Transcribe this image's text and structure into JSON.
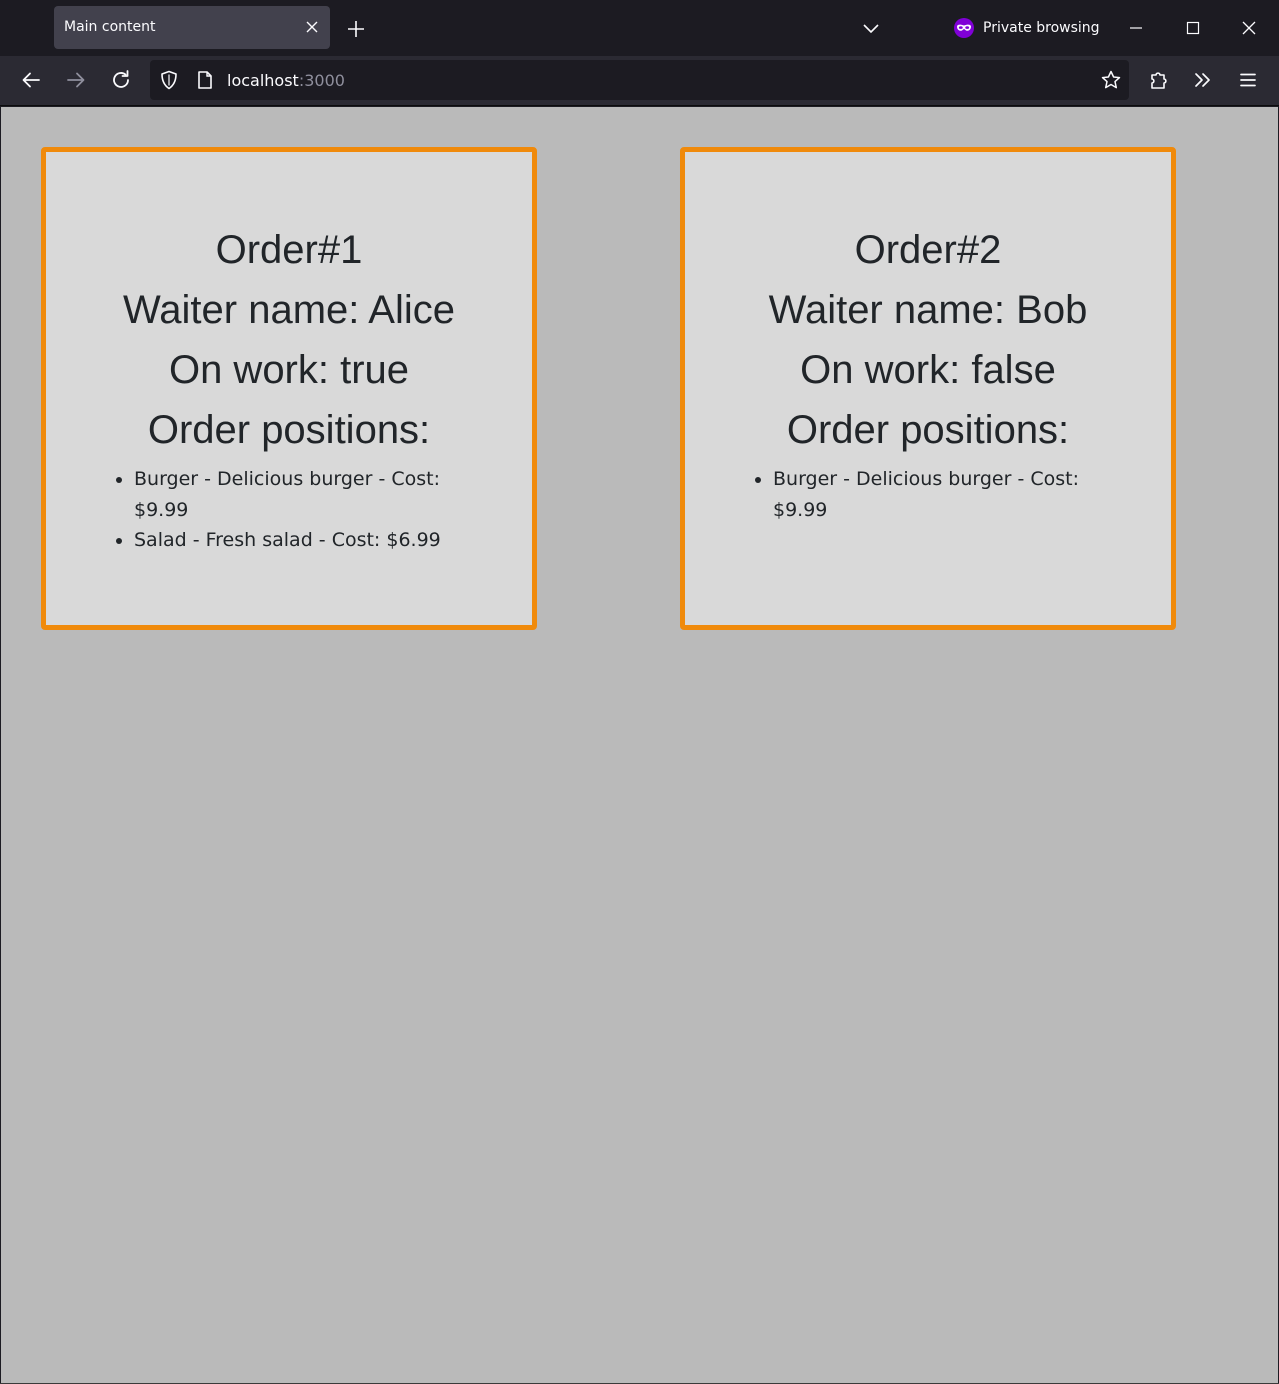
{
  "browser": {
    "tab": {
      "title": "Main content"
    },
    "private_label": "Private browsing",
    "url": {
      "host": "localhost",
      "port": ":3000"
    }
  },
  "colors": {
    "card_border": "#f08a0b",
    "card_background": "#d9d9d9",
    "page_background": "#bababa",
    "private_icon": "#8000d7"
  },
  "icons": {
    "tab_close": "close-icon",
    "new_tab": "plus-icon",
    "tab_list": "chevron-down-icon",
    "private": "private-mask-icon",
    "back": "arrow-left-icon",
    "forward": "arrow-right-icon",
    "reload": "reload-icon",
    "tracking": "shield-icon",
    "page": "page-icon",
    "bookmark": "star-icon",
    "extensions": "puzzle-icon",
    "overflow": "double-chevron-icon",
    "menu": "hamburger-icon"
  },
  "orders": [
    {
      "title": "Order#1",
      "waiter": "Waiter name: Alice",
      "on_work": "On work: true",
      "positions_heading": "Order positions:",
      "positions": [
        "Burger - Delicious burger - Cost: $9.99",
        "Salad - Fresh salad - Cost: $6.99"
      ]
    },
    {
      "title": "Order#2",
      "waiter": "Waiter name: Bob",
      "on_work": "On work: false",
      "positions_heading": "Order positions:",
      "positions": [
        "Burger - Delicious burger - Cost: $9.99"
      ]
    }
  ]
}
